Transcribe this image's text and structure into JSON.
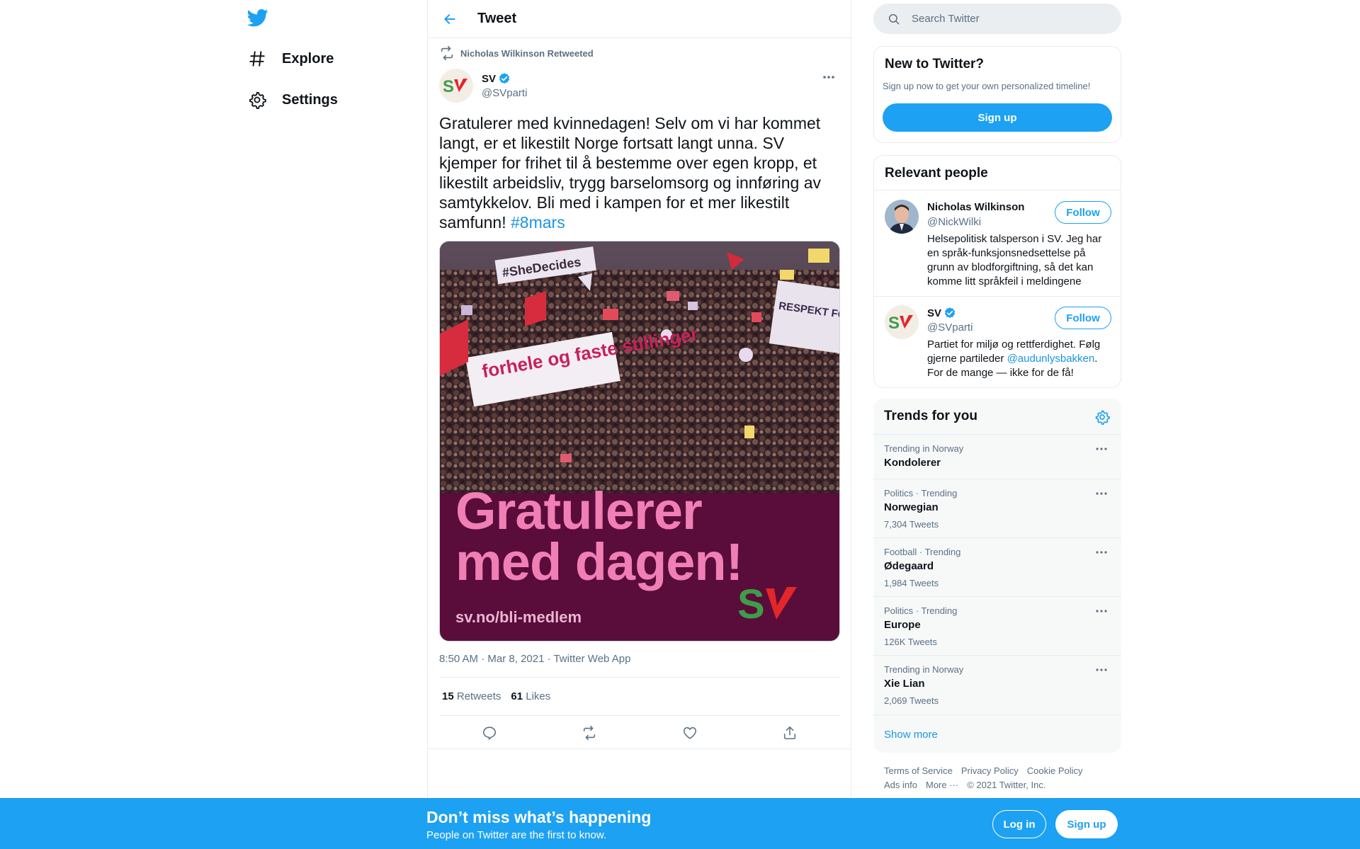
{
  "nav": {
    "logo_icon": "twitter-bird-icon",
    "items": [
      {
        "label": "Explore",
        "icon": "hashtag-icon"
      },
      {
        "label": "Settings",
        "icon": "gear-icon"
      }
    ]
  },
  "header": {
    "title": "Tweet",
    "back_icon": "arrow-left-icon"
  },
  "tweet": {
    "retweeted_by": "Nicholas Wilkinson Retweeted",
    "author_name": "SV",
    "author_handle": "@SVparti",
    "avatar_text": "SV",
    "text_main": "Gratulerer med kvinnedagen! Selv om vi har kommet langt, er et likestilt Norge fortsatt langt unna. SV kjemper for frihet til å bestemme over egen kropp, et likestilt arbeidsliv, trygg barselomsorg og innføring av samtykkelov. Bli med i kampen for et mer likestilt samfunn!",
    "hashtag": "#8mars",
    "media": {
      "banner_1": "#SheDecides",
      "banner_2": "forhele og faste stillinger",
      "banner_3": "RESPEKT FOR KVINNER",
      "headline_1": "Gratulerer",
      "headline_2": "med dagen!",
      "url": "sv.no/bli-medlem",
      "logo_text": "SV"
    },
    "meta": "8:50 AM · Mar 8, 2021 · Twitter Web App",
    "retweets_count": "15",
    "retweets_label": "Retweets",
    "likes_count": "61",
    "likes_label": "Likes"
  },
  "search": {
    "placeholder": "Search Twitter"
  },
  "new_to_twitter": {
    "title": "New to Twitter?",
    "subtitle": "Sign up now to get your own personalized timeline!",
    "button": "Sign up"
  },
  "relevant_people": {
    "title": "Relevant people",
    "people": [
      {
        "name": "Nicholas Wilkinson",
        "handle": "@NickWilki",
        "bio": "Helsepolitisk talsperson i SV. Jeg har en språk-funksjonsnedsettelse på grunn av blodforgiftning, så det kan komme litt språkfeil i meldingene",
        "follow": "Follow"
      },
      {
        "name": "SV",
        "handle": "@SVparti",
        "bio_before": "Partiet for miljø og rettferdighet. Følg gjerne partileder ",
        "bio_mention": "@audunlysbakken",
        "bio_after": ". For de mange — ikke for de få!",
        "follow": "Follow"
      }
    ]
  },
  "trends": {
    "title": "Trends for you",
    "items": [
      {
        "context": "Trending in Norway",
        "name": "Kondolerer",
        "count": ""
      },
      {
        "context": "Politics · Trending",
        "name": "Norwegian",
        "count": "7,304 Tweets"
      },
      {
        "context": "Football · Trending",
        "name": "Ødegaard",
        "count": "1,984 Tweets"
      },
      {
        "context": "Politics · Trending",
        "name": "Europe",
        "count": "126K Tweets"
      },
      {
        "context": "Trending in Norway",
        "name": "Xie Lian",
        "count": "2,069 Tweets"
      }
    ],
    "show_more": "Show more"
  },
  "footer": {
    "links": [
      "Terms of Service",
      "Privacy Policy",
      "Cookie Policy",
      "Ads info",
      "More ···"
    ],
    "copyright": "© 2021 Twitter, Inc."
  },
  "banner": {
    "title": "Don’t miss what’s happening",
    "subtitle": "People on Twitter are the first to know.",
    "login": "Log in",
    "signup": "Sign up"
  },
  "colors": {
    "brand": "#1da1f2",
    "link": "#1b95e0",
    "sv_green": "#3f9c4a",
    "sv_red": "#e2262a",
    "poster_bg": "#5a0c3a",
    "poster_pink": "#f07fb5"
  }
}
